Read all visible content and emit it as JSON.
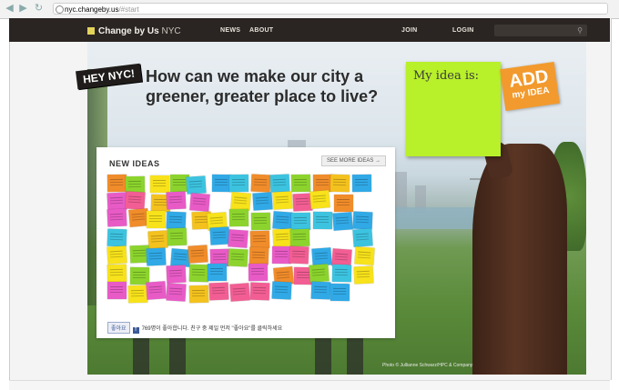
{
  "browser": {
    "url_host": "nyc.changeby.us",
    "url_path": "/#start"
  },
  "header": {
    "brand": "Change by Us",
    "city": "NYC",
    "nav": [
      "NEWS",
      "ABOUT"
    ],
    "join": "JOIN",
    "login": "LOGIN",
    "search_placeholder": ""
  },
  "hero": {
    "badge": "HEY NYC!",
    "headline_line1": "How can we make our city a",
    "headline_line2": "greener, greater place to live?",
    "idea_prompt": "My idea is:",
    "add_line1": "ADD",
    "add_line2": "my IDEA",
    "credit": "Photo © Jullianne Schwarz/HPC & Company"
  },
  "new_ideas": {
    "title": "NEW IDEAS",
    "see_more": "SEE MORE IDEAS →",
    "like_button": "좋아요",
    "like_text": "769명이 좋아합니다. 친구 중 제일 먼저 \"좋아요\"를 클릭하세요"
  },
  "colors": {
    "topbar": "#2a2523",
    "sticky": "#b8f02a",
    "add": "#f29a2d",
    "notes": [
      "#f7e21b",
      "#f08c2a",
      "#e85bc6",
      "#30a9e6",
      "#8cd42d",
      "#f4c21e",
      "#f25e93",
      "#3cc3e0"
    ]
  }
}
